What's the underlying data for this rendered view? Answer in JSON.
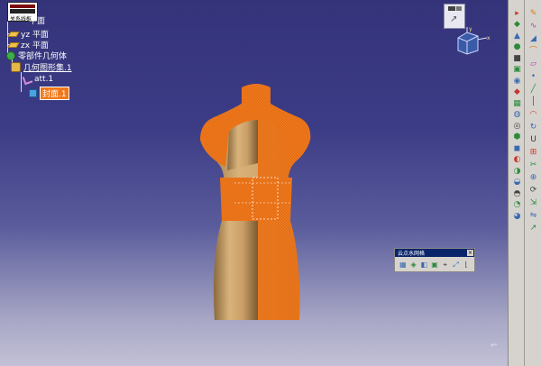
{
  "popup": {
    "text": "关系线框"
  },
  "tree": {
    "planes": [
      {
        "label": "平面",
        "axis_prefix": ""
      },
      {
        "label": "yz 平面"
      },
      {
        "label": "zx 平面"
      }
    ],
    "hybrid_body": "零部件几何体",
    "geo_set": "几何图形集.1",
    "att": "att.1",
    "fill": "封面.1"
  },
  "palette": {
    "title": "云点水网格"
  },
  "toolbar": {
    "icons_col1": [
      "a-icon",
      "b-icon",
      "c-icon",
      "d-icon",
      "e-icon",
      "f-icon",
      "g-icon",
      "h-icon",
      "i-icon",
      "j-icon",
      "k-icon",
      "l-icon",
      "m-icon",
      "n-icon",
      "o-icon",
      "p-icon",
      "q-icon",
      "r-icon",
      "s-icon"
    ],
    "icons_col2": [
      "sketch-icon",
      "curve-icon",
      "surface-icon",
      "offset-icon",
      "plane-icon",
      "point-icon",
      "line-icon",
      "axis-icon",
      "blend-icon",
      "sweep-icon",
      "u-icon",
      "ext-icon",
      "trim-icon",
      "join-icon",
      "rot-icon",
      "scale-icon",
      "mirror-icon",
      "arrow-icon"
    ]
  },
  "colors": {
    "background_top": "#34337a",
    "background_bottom": "#c3c1d6",
    "mesh_orange": "#f0781a",
    "mannequin_tan": "#c8a06a",
    "toolbar_gray": "#d6d3ce"
  }
}
